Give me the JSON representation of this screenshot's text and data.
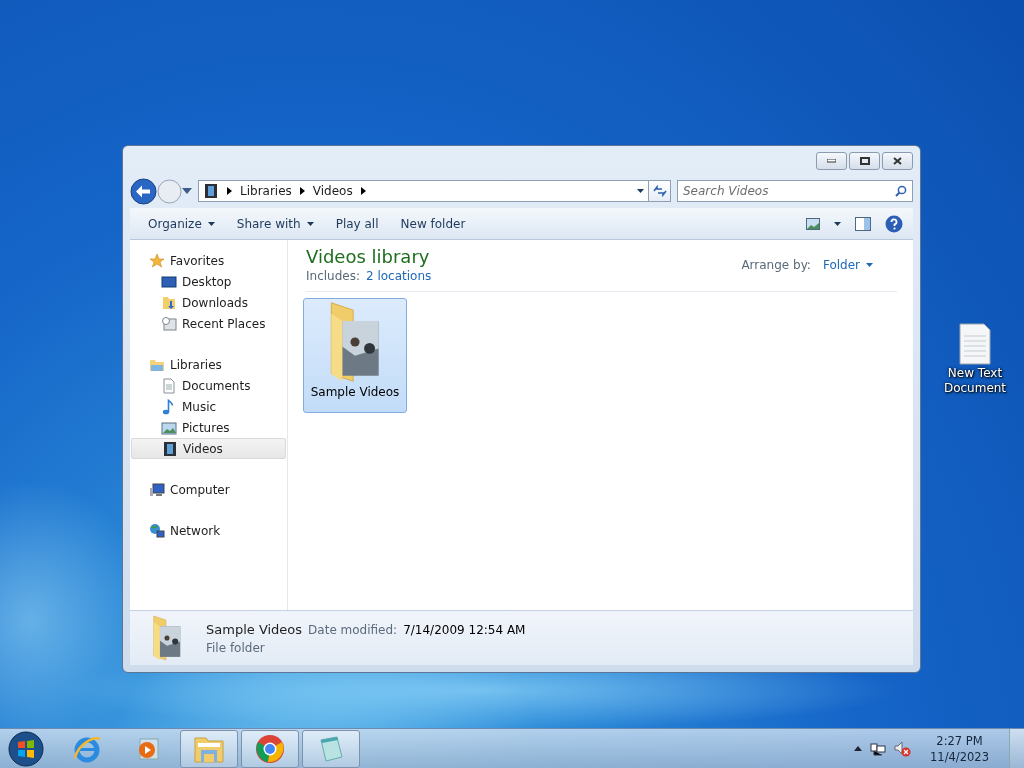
{
  "window": {
    "breadcrumb": [
      "Libraries",
      "Videos"
    ],
    "search": {
      "placeholder": "Search Videos"
    },
    "toolbar": [
      {
        "label": "Organize",
        "has_menu": true
      },
      {
        "label": "Share with",
        "has_menu": true
      },
      {
        "label": "Play all",
        "has_menu": false
      },
      {
        "label": "New folder",
        "has_menu": false
      }
    ],
    "nav": [
      {
        "label": "Favorites",
        "kind": "favorites",
        "selected": false,
        "children": [
          {
            "label": "Desktop",
            "kind": "desktop",
            "selected": false
          },
          {
            "label": "Downloads",
            "kind": "downloads",
            "selected": false
          },
          {
            "label": "Recent Places",
            "kind": "recent",
            "selected": false
          }
        ]
      },
      {
        "label": "Libraries",
        "kind": "libraries",
        "selected": false,
        "children": [
          {
            "label": "Documents",
            "kind": "documents",
            "selected": false
          },
          {
            "label": "Music",
            "kind": "music",
            "selected": false
          },
          {
            "label": "Pictures",
            "kind": "pictures",
            "selected": false
          },
          {
            "label": "Videos",
            "kind": "videos",
            "selected": true
          }
        ]
      },
      {
        "label": "Computer",
        "kind": "computer",
        "selected": false
      },
      {
        "label": "Network",
        "kind": "network",
        "selected": false
      }
    ],
    "library": {
      "title": "Videos library",
      "includes_label": "Includes:",
      "locations": "2 locations",
      "arrange_label": "Arrange by:",
      "arrange_value": "Folder"
    },
    "items": [
      {
        "label": "Sample Videos",
        "selected": true
      }
    ],
    "details": {
      "name": "Sample Videos",
      "date_label": "Date modified:",
      "date_value": "7/14/2009 12:54 AM",
      "type": "File folder"
    }
  },
  "desktop_icons": [
    {
      "label": "New Text Document"
    }
  ],
  "taskbar": {
    "apps": [
      {
        "kind": "ie",
        "open": false
      },
      {
        "kind": "media",
        "open": false
      },
      {
        "kind": "explorer",
        "open": true
      },
      {
        "kind": "chrome",
        "open": true
      },
      {
        "kind": "notepad",
        "open": true
      }
    ],
    "time": "2:27 PM",
    "date": "11/4/2023"
  }
}
